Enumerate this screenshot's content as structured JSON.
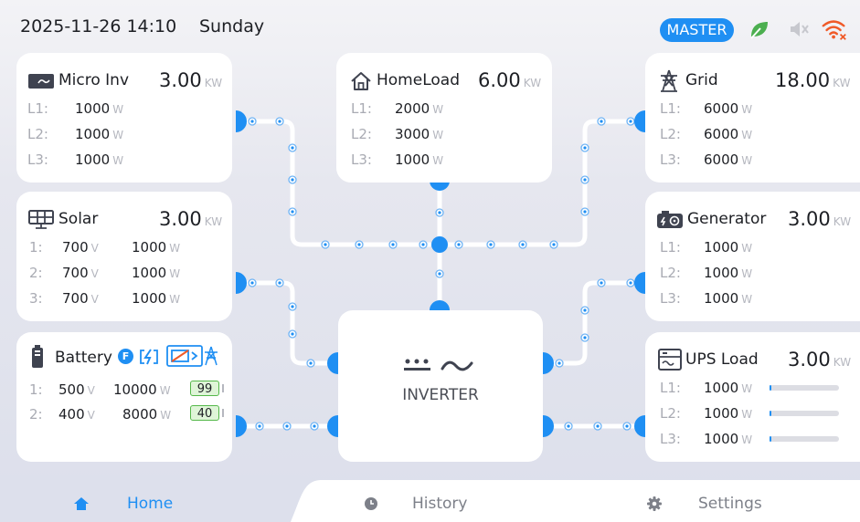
{
  "status_bar": {
    "datetime": "2025-11-26 14:10",
    "weekday": "Sunday",
    "role_badge": "MASTER",
    "icons": [
      "leaf-icon",
      "mute-icon",
      "wifi-alert-icon"
    ]
  },
  "cards": {
    "micro_inv": {
      "title": "Micro Inv",
      "value": "3.00",
      "unit": "KW",
      "icon": "micro-inverter-icon",
      "rows": [
        {
          "label": "L1:",
          "value": "1000",
          "unit": "W"
        },
        {
          "label": "L2:",
          "value": "1000",
          "unit": "W"
        },
        {
          "label": "L3:",
          "value": "1000",
          "unit": "W"
        }
      ]
    },
    "home_load": {
      "title": "HomeLoad",
      "value": "6.00",
      "unit": "KW",
      "icon": "house-icon",
      "rows": [
        {
          "label": "L1:",
          "value": "2000",
          "unit": "W"
        },
        {
          "label": "L2:",
          "value": "3000",
          "unit": "W"
        },
        {
          "label": "L3:",
          "value": "1000",
          "unit": "W"
        }
      ]
    },
    "grid": {
      "title": "Grid",
      "value": "18.00",
      "unit": "KW",
      "icon": "pylon-icon",
      "rows": [
        {
          "label": "L1:",
          "value": "6000",
          "unit": "W"
        },
        {
          "label": "L2:",
          "value": "6000",
          "unit": "W"
        },
        {
          "label": "L3:",
          "value": "6000",
          "unit": "W"
        }
      ]
    },
    "solar": {
      "title": "Solar",
      "value": "3.00",
      "unit": "KW",
      "icon": "solar-panel-icon",
      "rows": [
        {
          "label": "1:",
          "voltage": "700",
          "vunit": "V",
          "power": "1000",
          "punit": "W"
        },
        {
          "label": "2:",
          "voltage": "700",
          "vunit": "V",
          "power": "1000",
          "punit": "W"
        },
        {
          "label": "3:",
          "voltage": "700",
          "vunit": "V",
          "power": "1000",
          "punit": "W"
        }
      ]
    },
    "generator": {
      "title": "Generator",
      "value": "3.00",
      "unit": "KW",
      "icon": "generator-icon",
      "rows": [
        {
          "label": "L1:",
          "value": "1000",
          "unit": "W"
        },
        {
          "label": "L2:",
          "value": "1000",
          "unit": "W"
        },
        {
          "label": "L3:",
          "value": "1000",
          "unit": "W"
        }
      ]
    },
    "battery": {
      "title": "Battery",
      "icon": "battery-icon",
      "badge": "F",
      "status_icons": [
        "charging-icon",
        "battery-to-grid-icon"
      ],
      "rows": [
        {
          "label": "1:",
          "voltage": "500",
          "vunit": "V",
          "power": "10000",
          "punit": "W",
          "soc": "99"
        },
        {
          "label": "2:",
          "voltage": "400",
          "vunit": "V",
          "power": "8000",
          "punit": "W",
          "soc": "40"
        }
      ]
    },
    "ups_load": {
      "title": "UPS Load",
      "value": "3.00",
      "unit": "KW",
      "icon": "ups-icon",
      "rows": [
        {
          "label": "L1:",
          "value": "1000",
          "unit": "W",
          "level": 0.03
        },
        {
          "label": "L2:",
          "value": "1000",
          "unit": "W",
          "level": 0.03
        },
        {
          "label": "L3:",
          "value": "1000",
          "unit": "W",
          "level": 0.03
        }
      ]
    }
  },
  "inverter": {
    "label": "INVERTER",
    "icon": "dc-ac-icon"
  },
  "tabs": [
    {
      "label": "Home",
      "icon": "home-icon",
      "active": true
    },
    {
      "label": "History",
      "icon": "clock-icon",
      "active": false
    },
    {
      "label": "Settings",
      "icon": "gear-icon",
      "active": false
    }
  ],
  "colors": {
    "accent": "#1f8ff3",
    "leaf": "#4caf50",
    "alert": "#f05a28",
    "soc_green": "#55b84a"
  }
}
